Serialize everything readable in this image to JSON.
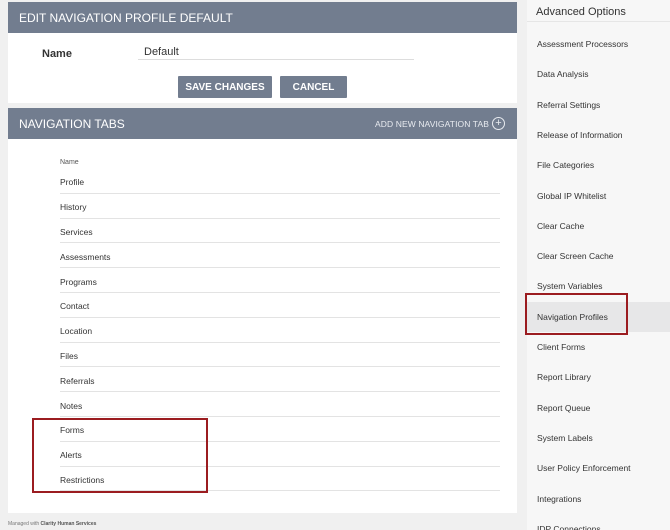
{
  "edit_panel": {
    "title": "EDIT NAVIGATION PROFILE DEFAULT",
    "name_label": "Name",
    "name_value": "Default",
    "save_label": "SAVE CHANGES",
    "cancel_label": "CANCEL"
  },
  "tabs_panel": {
    "title": "NAVIGATION TABS",
    "add_label": "ADD NEW NAVIGATION TAB",
    "column_header": "Name",
    "rows": [
      "Profile",
      "History",
      "Services",
      "Assessments",
      "Programs",
      "Contact",
      "Location",
      "Files",
      "Referrals",
      "Notes",
      "Forms",
      "Alerts",
      "Restrictions"
    ]
  },
  "footer": {
    "prefix": "Managed with",
    "brand": "Clarity Human Services"
  },
  "sidebar": {
    "title": "Advanced Options",
    "active_item": "Navigation Profiles",
    "items": [
      "Assessment Processors",
      "Data Analysis",
      "Referral Settings",
      "Release of Information",
      "File Categories",
      "Global IP Whitelist",
      "Clear Cache",
      "Clear Screen Cache",
      "System Variables",
      "Navigation Profiles",
      "Client Forms",
      "Report Library",
      "Report Queue",
      "System Labels",
      "User Policy Enforcement",
      "Integrations",
      "IDP Connections"
    ]
  },
  "colors": {
    "header_bg": "#727d8f",
    "highlight": "#9b1c20"
  },
  "icons": {
    "add": "plus-circle-icon"
  }
}
